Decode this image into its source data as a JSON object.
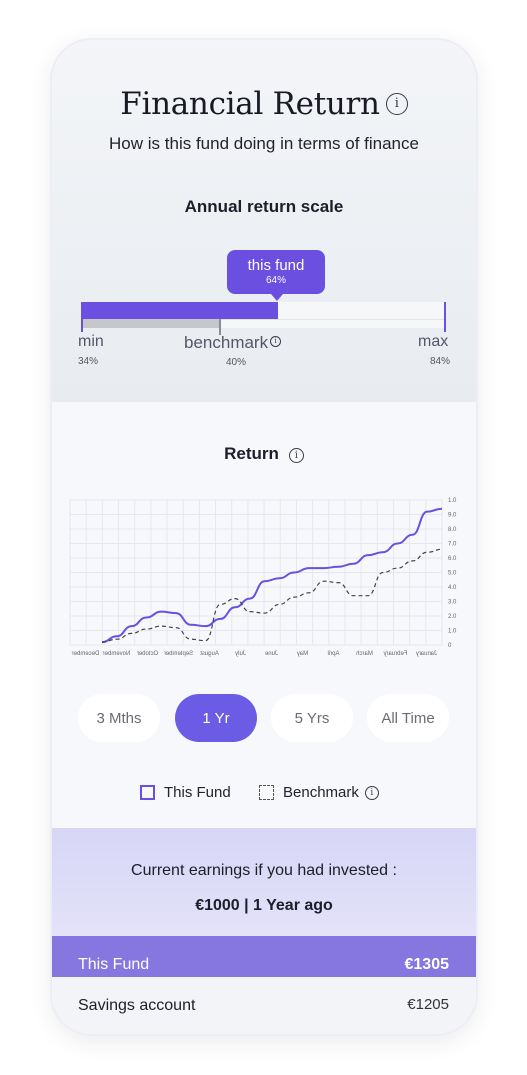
{
  "header": {
    "title": "Financial Return",
    "subtitle": "How is this fund doing in terms of finance"
  },
  "return_scale": {
    "title": "Annual return scale",
    "tooltip_label": "this fund",
    "fund_value": "64%",
    "min_label": "min",
    "min_value": "34%",
    "max_label": "max",
    "max_value": "84%",
    "benchmark_label": "benchmark",
    "benchmark_value": "40%",
    "fund_fill_fraction": 0.54,
    "benchmark_fill_fraction": 0.38,
    "colors": {
      "fund": "#6a4fe0",
      "benchmark": "#c5c7cb"
    }
  },
  "return_section": {
    "title": "Return"
  },
  "chart_data": {
    "type": "line",
    "x": [
      "December",
      "November",
      "October",
      "September",
      "August",
      "July",
      "June",
      "May",
      "April",
      "March",
      "February",
      "January"
    ],
    "x_labels_mirrored": true,
    "ylim": [
      0,
      1.0
    ],
    "y_ticks": [
      "0",
      "1.0",
      "2.0",
      "3.0",
      "4.0",
      "5.0",
      "6.0",
      "7.0",
      "8.0",
      "9.0",
      "1.0"
    ],
    "grid": true,
    "series": [
      {
        "name": "This Fund",
        "style": "solid",
        "color": "#6a4fe0",
        "points": [
          [
            0,
            0.02
          ],
          [
            0.5,
            0.06
          ],
          [
            1,
            0.13
          ],
          [
            1.5,
            0.19
          ],
          [
            2,
            0.23
          ],
          [
            2.5,
            0.22
          ],
          [
            3,
            0.14
          ],
          [
            3.5,
            0.13
          ],
          [
            4,
            0.18
          ],
          [
            4.5,
            0.26
          ],
          [
            5,
            0.32
          ],
          [
            5.5,
            0.44
          ],
          [
            6,
            0.46
          ],
          [
            6.5,
            0.5
          ],
          [
            7,
            0.53
          ],
          [
            7.5,
            0.53
          ],
          [
            8,
            0.54
          ],
          [
            8.5,
            0.56
          ],
          [
            9,
            0.62
          ],
          [
            9.5,
            0.64
          ],
          [
            10,
            0.7
          ],
          [
            10.5,
            0.76
          ],
          [
            11,
            0.92
          ],
          [
            11.5,
            0.94
          ]
        ]
      },
      {
        "name": "Benchmark",
        "style": "dashed",
        "color": "#444444",
        "points": [
          [
            0,
            0.02
          ],
          [
            0.5,
            0.04
          ],
          [
            1,
            0.08
          ],
          [
            1.5,
            0.11
          ],
          [
            2,
            0.13
          ],
          [
            2.5,
            0.12
          ],
          [
            3,
            0.04
          ],
          [
            3.5,
            0.03
          ],
          [
            4,
            0.28
          ],
          [
            4.5,
            0.32
          ],
          [
            5,
            0.23
          ],
          [
            5.5,
            0.22
          ],
          [
            6,
            0.28
          ],
          [
            6.5,
            0.33
          ],
          [
            7,
            0.36
          ],
          [
            7.5,
            0.44
          ],
          [
            8,
            0.43
          ],
          [
            8.5,
            0.34
          ],
          [
            9,
            0.34
          ],
          [
            9.5,
            0.5
          ],
          [
            10,
            0.53
          ],
          [
            10.5,
            0.58
          ],
          [
            11,
            0.64
          ],
          [
            11.5,
            0.66
          ]
        ]
      }
    ]
  },
  "periods": [
    {
      "label": "3 Mths",
      "active": false
    },
    {
      "label": "1 Yr",
      "active": true
    },
    {
      "label": "5 Yrs",
      "active": false
    },
    {
      "label": "All Time",
      "active": false
    }
  ],
  "legend": {
    "fund": "This Fund",
    "benchmark": "Benchmark"
  },
  "earnings": {
    "line1": "Current earnings if you had invested :",
    "line2": "€1000 | 1 Year ago",
    "rows": [
      {
        "label": "This Fund",
        "value": "€1305"
      },
      {
        "label": "Savings account",
        "value": "€1205"
      }
    ]
  },
  "icons": [
    "info-icon"
  ]
}
